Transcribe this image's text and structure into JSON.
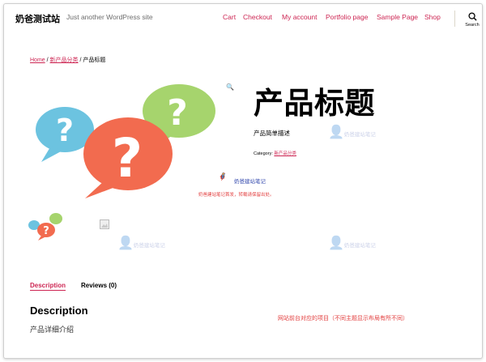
{
  "site": {
    "title": "奶爸测试站",
    "tagline": "Just another WordPress site"
  },
  "nav": {
    "items": [
      {
        "label": "Cart"
      },
      {
        "label": "Checkout"
      },
      {
        "label": "My account"
      },
      {
        "label": "Portfolio page"
      },
      {
        "label": "Sample Page"
      },
      {
        "label": "Shop"
      }
    ],
    "search_label": "Search"
  },
  "breadcrumb": {
    "home": "Home",
    "sep1": " / ",
    "category": "新产品分类",
    "sep2": " / ",
    "current": "产品标题"
  },
  "product": {
    "title": "产品标题",
    "short_description": "产品简单描述",
    "category_label": "Category: ",
    "category_value": "新产品分类"
  },
  "watermark": {
    "brand": "奶爸建站笔记",
    "note": "奶爸建站笔记首发，转载请保留出处。"
  },
  "tabs": {
    "description": "Description",
    "reviews": "Reviews (0)"
  },
  "description": {
    "heading": "Description",
    "body": "产品详细介绍"
  },
  "annotation": "网站前台对应的项目（不同主题显示布局有所不同）",
  "colors": {
    "accent": "#cd2653",
    "bubble_blue": "#6cc3e0",
    "bubble_orange": "#f26b4f",
    "bubble_green": "#a6d46d"
  }
}
